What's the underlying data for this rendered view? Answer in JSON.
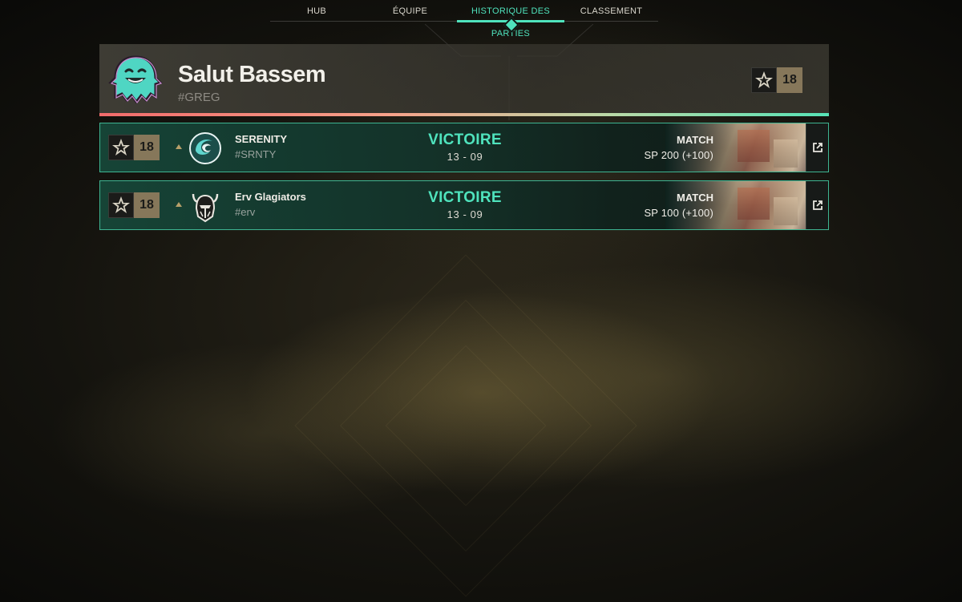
{
  "nav": {
    "tabs": [
      {
        "label": "HUB",
        "active": false
      },
      {
        "label": "ÉQUIPE",
        "active": false
      },
      {
        "label": "HISTORIQUE DES PARTIES",
        "active": true
      },
      {
        "label": "CLASSEMENT",
        "active": false
      }
    ]
  },
  "profile": {
    "name": "Salut Bassem",
    "tag": "#GREG",
    "rank_level": "18",
    "avatar_icon": "ghost-avatar-icon"
  },
  "matches": [
    {
      "rank_level": "18",
      "team_name": "SERENITY",
      "team_tag": "#SRNTY",
      "team_logo_icon": "serenity-wave-logo-icon",
      "result": "VICTOIRE",
      "score": "13 - 09",
      "mode": "MATCH",
      "sp": "SP 200 (+100)"
    },
    {
      "rank_level": "18",
      "team_name": "Erv Glagiators",
      "team_tag": "#erv",
      "team_logo_icon": "gladiator-helmet-logo-icon",
      "result": "VICTOIRE",
      "score": "13 - 09",
      "mode": "MATCH",
      "sp": "SP 100 (+100)"
    }
  ],
  "colors": {
    "accent": "#4fe3bd",
    "rank_gold": "#86775a",
    "row_border": "#3eb592"
  }
}
